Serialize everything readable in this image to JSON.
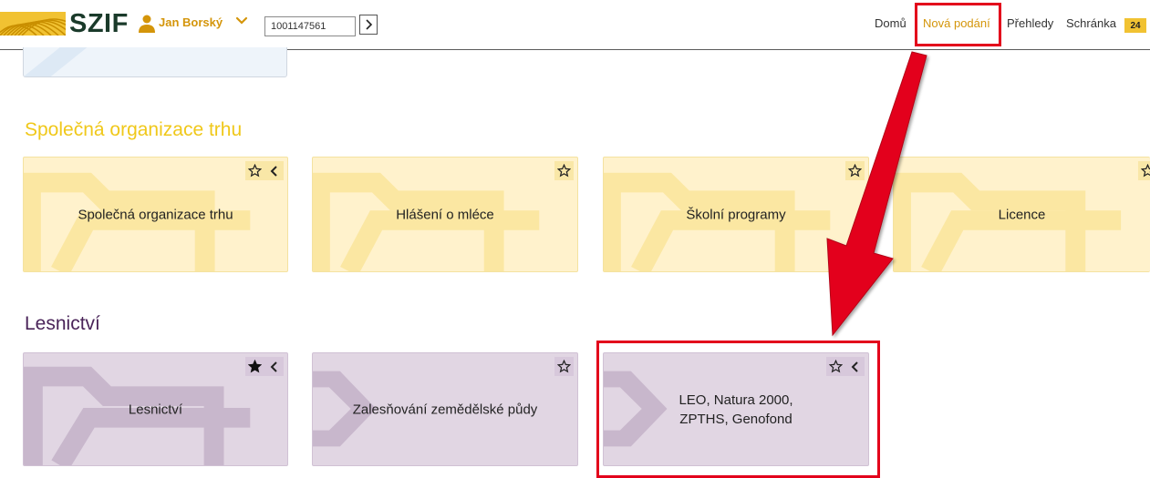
{
  "header": {
    "logo_text": "SZIF",
    "user_name": "Jan Borský",
    "id_value": "1001147561",
    "go_icon": "chevron-right-icon",
    "nav": {
      "home": "Domů",
      "new_submissions": "Nová podání",
      "overviews": "Přehledy",
      "inbox": "Schránka",
      "inbox_count": "24"
    }
  },
  "sections": {
    "market": {
      "title": "Společná organizace trhu",
      "tiles": [
        {
          "label": "Společná organizace trhu",
          "favorite": false,
          "expandable": true
        },
        {
          "label": "Hlášení o mléce",
          "favorite": false,
          "expandable": false
        },
        {
          "label": "Školní programy",
          "favorite": false,
          "expandable": false
        },
        {
          "label": "Licence",
          "favorite": false,
          "expandable": false
        }
      ]
    },
    "forestry": {
      "title": "Lesnictví",
      "tiles": [
        {
          "label": "Lesnictví",
          "favorite": true,
          "expandable": true
        },
        {
          "label": "Zalesňování zemědělské půdy",
          "favorite": false,
          "expandable": false
        },
        {
          "label": "LEO, Natura 2000, ZPTHS, Genofond",
          "favorite": false,
          "expandable": true
        }
      ]
    }
  },
  "colors": {
    "accent": "#d4950a",
    "market_title": "#f0c81a",
    "forestry_title": "#4a2459",
    "market_tile": "#fff2cc",
    "forestry_tile": "#e1d6e3",
    "annotation": "#e3001b",
    "badge": "#f1c232"
  }
}
